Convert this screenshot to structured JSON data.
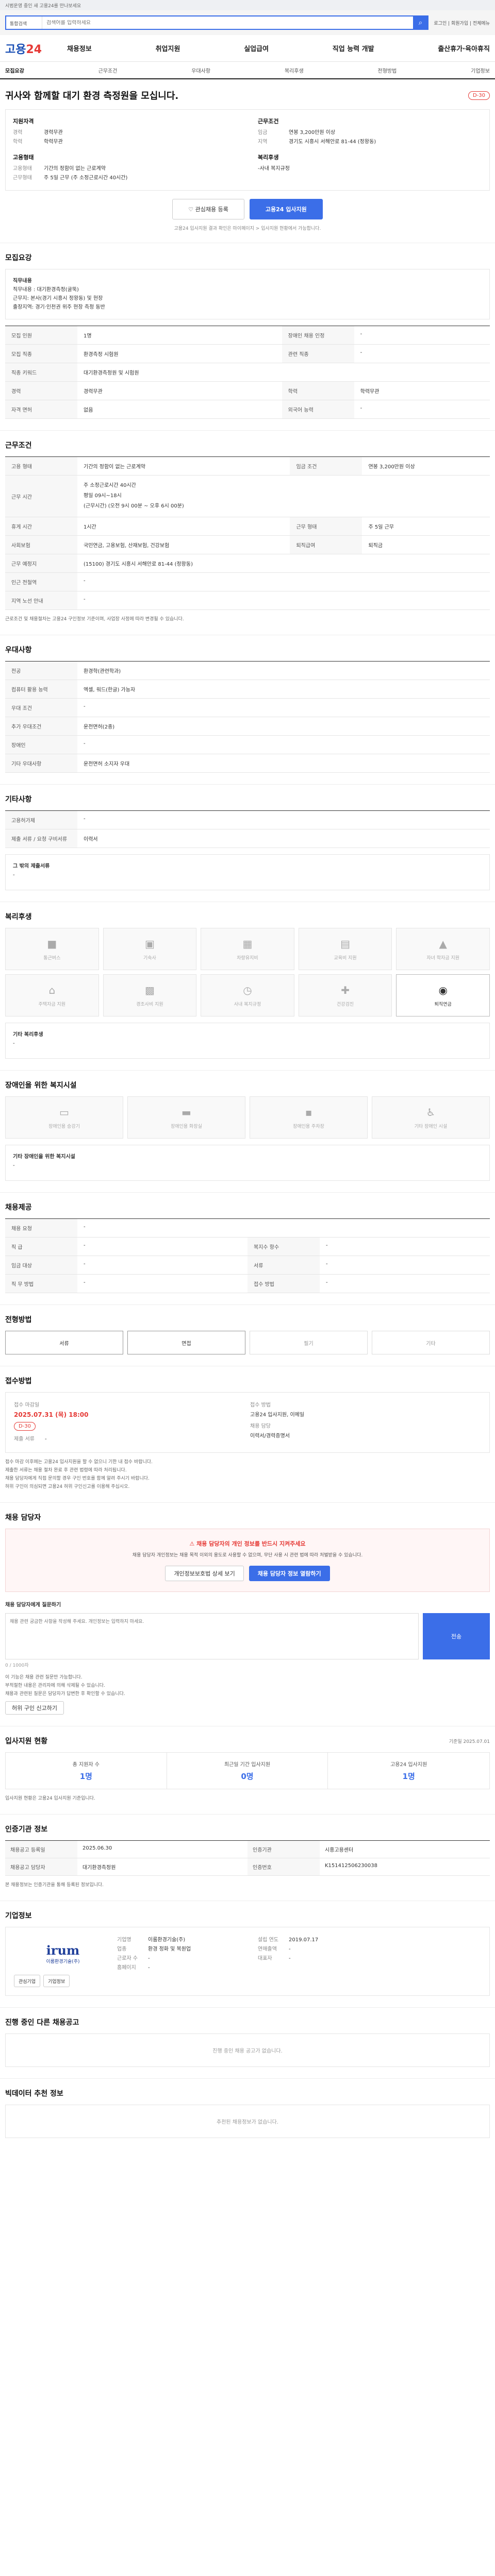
{
  "topbar": {
    "notice": "시범운영 중인 새 고용24를 만나보세요"
  },
  "search": {
    "category": "통합검색",
    "placeholder": "검색어를 입력하세요",
    "util": "로그인 | 회원가입 | 전체메뉴"
  },
  "gnb": {
    "logo_main": "고용",
    "logo_num": "24",
    "menu": [
      "채용정보",
      "취업지원",
      "실업급여",
      "직업 능력 개발",
      "출산휴가·육아휴직"
    ]
  },
  "subnav": [
    "모집요강",
    "근무조건",
    "우대사항",
    "복리후생",
    "전형방법",
    "기업정보"
  ],
  "job": {
    "title": "귀사와 함께할 대기 환경 측정원을 모십니다.",
    "dday": "D-30",
    "left_h": "지원자격",
    "exp_k": "경력",
    "exp_v": "경력무관",
    "edu_k": "학력",
    "edu_v": "학력무관",
    "emp_h": "고용형태",
    "emp_k": "고용형태",
    "emp_v": "기간의 정함이 없는 근로계약",
    "work_k": "근무형태",
    "work_v": "주 5일 근무 (주 소정근로시간 40시간)",
    "right_h": "근무조건",
    "pay_k": "임금",
    "pay_v": "연봉 3,200만원 이상",
    "loc_k": "지역",
    "loc_v": "경기도 시흥시 서해안로 81-44 (정왕동)",
    "wel_h": "복리후생",
    "wel_v": "-사내 복지규정",
    "scrap": "관심채용 등록",
    "apply": "고용24 입사지원",
    "note": "고용24 입사지원 결과 확인은 마이페이지 > 입사지원 현황에서 가능합니다."
  },
  "recruit": {
    "title": "모집요강",
    "desc_h": "직무내용",
    "desc": "직무내용 : 대기환경측정(굴뚝)\n근무지: 본사(경기 시흥시 정왕동) 및 현장\n출장지역: 경기·인천권 위주 현장 측정 동반",
    "rows": [
      [
        "모집 인원",
        "1명",
        "장애인 채용 인정",
        "-"
      ],
      [
        "모집 직종",
        "환경측정 시험원",
        "관련 직종",
        "-"
      ],
      [
        "직종 키워드",
        "대기환경측정원 및 시험원",
        "",
        ""
      ],
      [
        "경력",
        "경력무관",
        "학력",
        "학력무관"
      ],
      [
        "자격 면허",
        "없음",
        "외국어 능력",
        "-"
      ]
    ]
  },
  "conditions": {
    "title": "근무조건",
    "rows": [
      [
        "고용 형태",
        "기간의 정함이 없는 근로계약",
        "임금 조건",
        "연봉 3,200만원 이상"
      ],
      [
        "근무 시간",
        "주 소정근로시간 40시간\n평일 09시~18시\n(근무시간) (오전 9시 00분 ~ 오후 6시 00분)",
        "",
        ""
      ],
      [
        "휴게 시간",
        "1시간",
        "근무 형태",
        "주 5일 근무"
      ],
      [
        "사회보험",
        "국민연금, 고용보험, 산재보험, 건강보험",
        "퇴직급여",
        "퇴직금"
      ],
      [
        "근무 예정지",
        "(15100) 경기도 시흥시 서해안로 81-44 (정왕동)",
        "",
        ""
      ],
      [
        "인근 전철역",
        "-",
        "",
        ""
      ],
      [
        "지역 노선 안내",
        "-",
        "",
        ""
      ]
    ],
    "footnote": "근로조건 및 채용절차는 고용24 구인정보 기준이며, 사업장 사정에 따라 변경될 수 있습니다."
  },
  "prefer": {
    "title": "우대사항",
    "rows": [
      [
        "전공",
        "환경학(관련학과)"
      ],
      [
        "컴퓨터 활용 능력",
        "엑셀, 워드(한글) 가능자"
      ],
      [
        "우대 조건",
        "-"
      ],
      [
        "추가 우대조건",
        "운전면허(2종)"
      ],
      [
        "장애인",
        "-"
      ],
      [
        "기타 우대사항",
        "운전면허 소지자 우대"
      ]
    ]
  },
  "other": {
    "title": "기타사항",
    "rows": [
      [
        "고용허가제",
        "-"
      ],
      [
        "제출 서류 / 요청 구비서류",
        "이력서"
      ]
    ],
    "desc_h": "그 밖의 제출서류",
    "desc": "-"
  },
  "welfare": {
    "title": "복리후생",
    "items": [
      "통근버스",
      "기숙사",
      "차량유지비",
      "교육비 지원",
      "자녀 학자금 지원",
      "주택자금 지원",
      "경조사비 지원",
      "사내 복지규정",
      "건강검진",
      "퇴직연금"
    ],
    "desc_h": "기타 복리후생",
    "desc": "-"
  },
  "disabled": {
    "title": "장애인을 위한 복지시설",
    "items": [
      "장애인용 승강기",
      "장애인용 화장실",
      "장애인용 주차장",
      "기타 장애인 시설"
    ],
    "desc_h": "기타 장애인을 위한 복지시설",
    "desc": "-"
  },
  "worker": {
    "title": "채용제공",
    "rows": [
      [
        "채용 요청",
        "-"
      ],
      [
        "직 급",
        "-",
        "복지수 항수",
        "-"
      ],
      [
        "임금 대상",
        "-",
        "서류",
        "-"
      ],
      [
        "직 무 방법",
        "-",
        "접수 방법",
        "-"
      ]
    ]
  },
  "method": {
    "title": "전형방법",
    "steps": [
      "서류",
      "면접",
      "필기",
      "기타"
    ]
  },
  "apply": {
    "title": "접수방법",
    "period_k": "접수 마감일",
    "period_v": "2025.07.31 (목) 18:00",
    "dday": "D-30",
    "method_k": "접수 방법",
    "method_v": "고용24 입사지원, 이메일",
    "form_k": "제출 서류",
    "form_v": "-",
    "person_k": "채용 담당",
    "person_v": "이력서/경력증명서",
    "bullets": [
      "접수 마감 이후에는 고용24 입사지원을 할 수 없으니 기한 내 접수 바랍니다.",
      "제출한 서류는 채용 절차 완료 후 관련 법령에 따라 처리됩니다.",
      "채용 담당자에게 직접 문의할 경우 구인 번호를 함께 알려 주시기 바랍니다.",
      "허위 구인이 의심되면 고용24 허위 구인신고를 이용해 주십시오."
    ]
  },
  "contact": {
    "title": "채용 담당자",
    "warn": "채용 담당자의 개인 정보를 반드시 지켜주세요",
    "warn_desc": "채용 담당자 개인정보는 채용 목적 이외의 용도로 사용할 수 없으며, 무단 사용 시 관련 법에 따라 처벌받을 수 있습니다.",
    "btn1": "개인정보보호법 상세 보기",
    "btn2": "채용 담당자 정보 열람하기",
    "qa_label": "채용 담당자에게 질문하기",
    "qa_placeholder": "채용 관련 궁금한 사항을 작성해 주세요. 개인정보는 입력하지 마세요.",
    "qa_count": "0 / 1000자",
    "qa_send": "전송",
    "bullets": [
      "이 기능은 채용 관련 질문만 가능합니다.",
      "부적절한 내용은 관리자에 의해 삭제될 수 있습니다.",
      "채용과 관련된 질문은 담당자가 답변한 후 확인할 수 있습니다."
    ],
    "report": "허위 구인 신고하기"
  },
  "stats": {
    "title": "입사지원 현황",
    "date": "기준일 2025.07.01",
    "items": [
      [
        "총 지원자 수",
        "1명"
      ],
      [
        "최근일 기간 입사지원",
        "0명"
      ],
      [
        "고용24 입사지원",
        "1명"
      ]
    ],
    "note": "입사지원 현황은 고용24 입사지원 기준입니다."
  },
  "cert": {
    "title": "인증기관 정보",
    "rows": [
      [
        "채용공고 등록일",
        "2025.06.30",
        "인증기관",
        "시흥고용센터"
      ],
      [
        "채용공고 담당자",
        "대기환경측정원",
        "인증번호",
        "K151412506230038"
      ]
    ],
    "note": "본 채용정보는 인증기관을 통해 등록된 정보입니다."
  },
  "company": {
    "title": "기업정보",
    "logo": "irum",
    "logo_sub": "이룸환경기술(주)",
    "btn_like": "관심기업",
    "btn_info": "기업정보",
    "rows": [
      [
        "기업명",
        "이룸환경기술(주)"
      ],
      [
        "업종",
        "환경 정화 및 복원업"
      ],
      [
        "근로자 수",
        "-"
      ],
      [
        "홈페이지",
        "-"
      ]
    ],
    "rows2": [
      [
        "설립 연도",
        "2019.07.17"
      ],
      [
        "연매출액",
        "-"
      ],
      [
        "대표자",
        "-"
      ]
    ]
  },
  "others": {
    "title": "진행 중인 다른 채용공고",
    "empty": "진행 중인 채용 공고가 없습니다."
  },
  "recommend": {
    "title": "빅데이터 추천 정보",
    "empty": "추천된 채용정보가 없습니다."
  }
}
